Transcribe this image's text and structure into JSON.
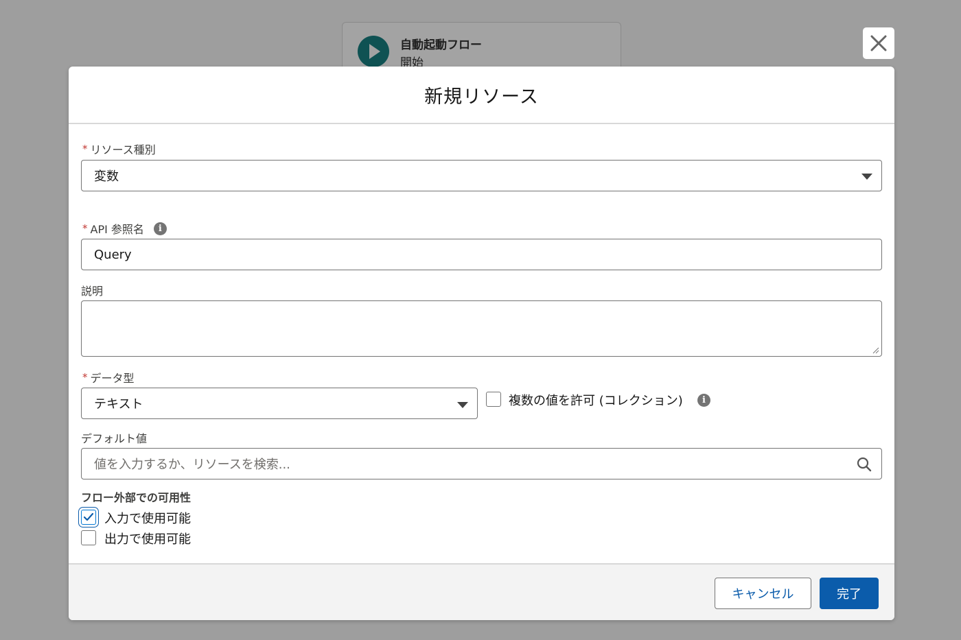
{
  "background": {
    "start_node": {
      "title": "自動起動フロー",
      "subtitle": "開始"
    }
  },
  "modal": {
    "title": "新規リソース",
    "resource_type": {
      "label": "リソース種別",
      "value": "変数"
    },
    "api_name": {
      "label": "API 参照名",
      "value": "Query"
    },
    "description": {
      "label": "説明",
      "value": ""
    },
    "data_type": {
      "label": "データ型",
      "value": "テキスト"
    },
    "allow_multiple": {
      "label": "複数の値を許可 (コレクション)",
      "checked": false
    },
    "default_value": {
      "label": "デフォルト値",
      "placeholder": "値を入力するか、リソースを検索..."
    },
    "availability": {
      "title": "フロー外部での可用性",
      "input_label": "入力で使用可能",
      "input_checked": true,
      "output_label": "出力で使用可能",
      "output_checked": false
    },
    "footer": {
      "cancel_label": "キャンセル",
      "done_label": "完了"
    }
  },
  "colors": {
    "brand": "#0b5cab",
    "required": "#c23934",
    "overlay": "#9e9e9e"
  }
}
